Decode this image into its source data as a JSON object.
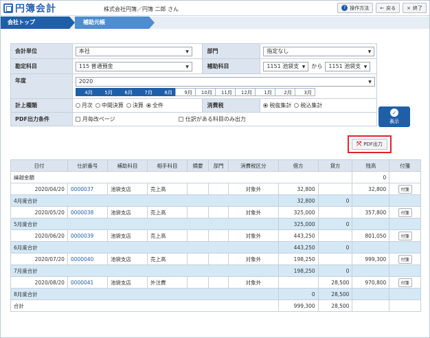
{
  "header": {
    "logo_text": "円簿会計",
    "company": "株式会社円簿／円簿 二郎 さん",
    "buttons": [
      {
        "icon": "?",
        "label": "操作方法"
      },
      {
        "icon": "←",
        "label": "戻る"
      },
      {
        "icon": "×",
        "label": "終了"
      }
    ]
  },
  "breadcrumb": [
    "会社トップ",
    "補助元帳"
  ],
  "conditions": {
    "unit_label": "会計単位",
    "unit_value": "本社",
    "dept_label": "部門",
    "dept_value": "指定なし",
    "account_label": "勘定科目",
    "account_value": "115 普通預金",
    "sub_label": "補助科目",
    "sub_from": "1151 池袋支",
    "sub_to_label": "から",
    "sub_to": "1151 池袋支",
    "year_label": "年度",
    "year_value": "2020",
    "months": [
      "4月",
      "5月",
      "6月",
      "7月",
      "8月",
      "9月",
      "10月",
      "11月",
      "12月",
      "1月",
      "2月",
      "3月"
    ],
    "entry_label": "計上種類",
    "entry_options": [
      "月次",
      "中間決算",
      "決算",
      "全件"
    ],
    "tax_label": "消費税",
    "tax_options": [
      "税抜集計",
      "税込集計"
    ],
    "pdf_label": "PDF出力条件",
    "pdf_opt1": "月毎改ページ",
    "pdf_opt2": "仕訳がある科目のみ出力"
  },
  "display_button": "表示",
  "pdf_button": "PDF出力",
  "table": {
    "headers": [
      "日付",
      "仕訳番号",
      "補助科目",
      "相手科目",
      "摘要",
      "部門",
      "消費税区分",
      "借方",
      "貸方",
      "残高",
      "付箋"
    ],
    "carry_label": "繰越金額",
    "carry_balance": "0",
    "rows": [
      {
        "type": "entry",
        "date": "2020/04/20",
        "no": "0000037",
        "sub": "池袋支店",
        "partner": "売上高",
        "tax": "対象外",
        "debit": "32,800",
        "credit": "",
        "balance": "32,800",
        "tag": "付箋"
      },
      {
        "type": "sum",
        "label": "4月度合計",
        "debit": "32,800",
        "credit": "0"
      },
      {
        "type": "entry",
        "date": "2020/05/20",
        "no": "0000038",
        "sub": "池袋支店",
        "partner": "売上高",
        "tax": "対象外",
        "debit": "325,000",
        "credit": "",
        "balance": "357,800",
        "tag": "付箋"
      },
      {
        "type": "sum",
        "label": "5月度合計",
        "debit": "325,000",
        "credit": "0"
      },
      {
        "type": "entry",
        "date": "2020/06/20",
        "no": "0000039",
        "sub": "池袋支店",
        "partner": "売上高",
        "tax": "対象外",
        "debit": "443,250",
        "credit": "",
        "balance": "801,050",
        "tag": "付箋"
      },
      {
        "type": "sum",
        "label": "6月度合計",
        "debit": "443,250",
        "credit": "0"
      },
      {
        "type": "entry",
        "date": "2020/07/20",
        "no": "0000040",
        "sub": "池袋支店",
        "partner": "売上高",
        "tax": "対象外",
        "debit": "198,250",
        "credit": "",
        "balance": "999,300",
        "tag": "付箋"
      },
      {
        "type": "sum",
        "label": "7月度合計",
        "debit": "198,250",
        "credit": "0"
      },
      {
        "type": "entry",
        "date": "2020/08/20",
        "no": "0000041",
        "sub": "池袋支店",
        "partner": "外注費",
        "tax": "対象外",
        "debit": "",
        "credit": "28,500",
        "balance": "970,800",
        "tag": "付箋"
      },
      {
        "type": "sum",
        "label": "8月度合計",
        "debit": "0",
        "credit": "28,500"
      }
    ],
    "total_label": "合計",
    "total_debit": "999,300",
    "total_credit": "28,500"
  }
}
